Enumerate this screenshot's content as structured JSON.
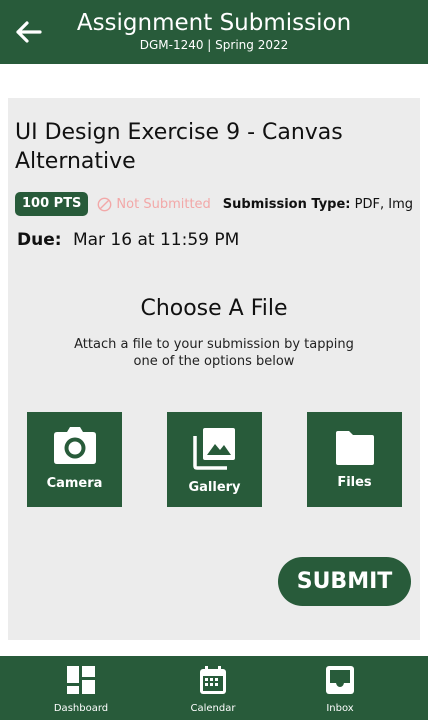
{
  "header": {
    "title": "Assignment Submission",
    "subtitle": "DGM-1240 | Spring 2022",
    "back_icon": "arrow-left-icon"
  },
  "assignment": {
    "title": "UI Design Exercise 9 - Canvas Alternative",
    "points": "100 PTS",
    "status": "Not Submitted",
    "submission_type_label": "Submission Type:",
    "submission_type_value": "PDF, Img",
    "due_label": "Due:",
    "due_value": "Mar 16 at 11:59 PM"
  },
  "file_chooser": {
    "title": "Choose A File",
    "description": "Attach a file to your submission by tapping one of the options below",
    "options": [
      {
        "label": "Camera",
        "icon": "camera-icon"
      },
      {
        "label": "Gallery",
        "icon": "gallery-icon"
      },
      {
        "label": "Files",
        "icon": "folder-icon"
      }
    ]
  },
  "submit_label": "SUBMIT",
  "bottom_nav": {
    "items": [
      {
        "label": "Dashboard",
        "icon": "dashboard-icon"
      },
      {
        "label": "Calendar",
        "icon": "calendar-icon"
      },
      {
        "label": "Inbox",
        "icon": "inbox-icon"
      }
    ]
  },
  "colors": {
    "primary": "#285b3a",
    "card_background": "#ececec",
    "status_text": "#f2a8a8"
  }
}
